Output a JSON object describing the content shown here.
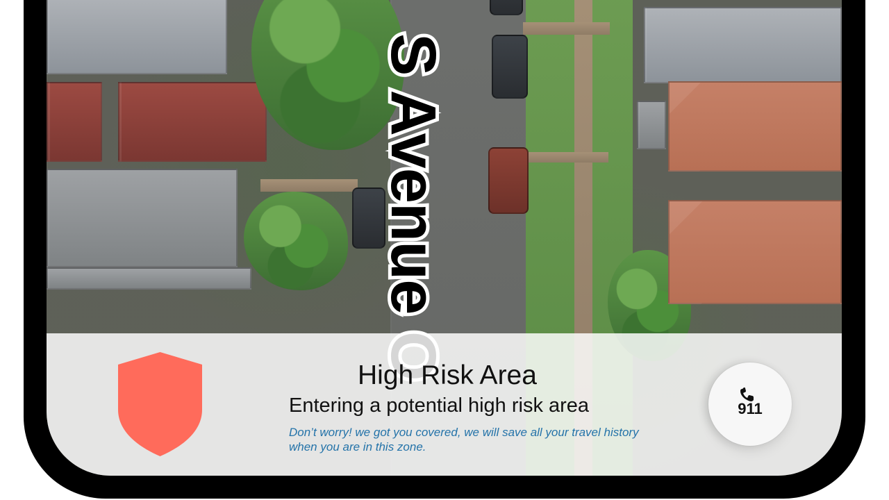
{
  "map": {
    "street_name": "S Avenue O"
  },
  "alert": {
    "title": "High Risk Area",
    "subtitle": "Entering a potential high risk area",
    "note": "Don’t worry! we got you covered, we will save all your travel history when you are in this zone."
  },
  "call_button": {
    "label": "911",
    "icon": "phone-icon"
  },
  "colors": {
    "shield": "#ff6b5b",
    "note": "#2473a9",
    "bezel": "#000000"
  },
  "icons": {
    "shield": "shield-icon",
    "phone": "phone-icon"
  }
}
